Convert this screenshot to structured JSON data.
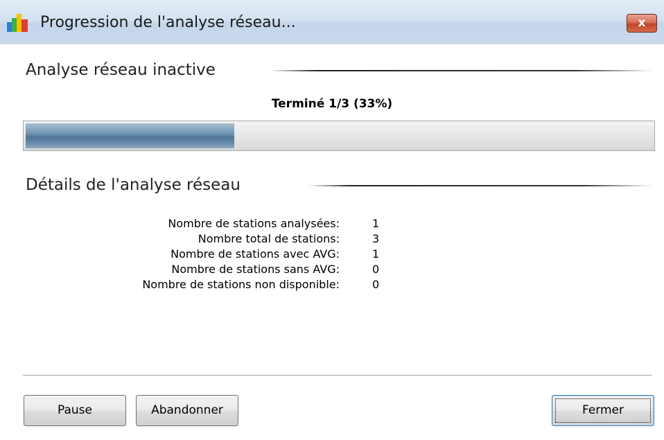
{
  "window": {
    "title": "Progression de l'analyse réseau...",
    "close_glyph": "x"
  },
  "status": {
    "heading": "Analyse réseau inactive",
    "progress_label": "Terminé 1/3 (33%)",
    "progress_fraction": 0.333
  },
  "details": {
    "heading": "Détails de l'analyse réseau",
    "rows": [
      {
        "label": "Nombre de stations analysées:",
        "value": "1"
      },
      {
        "label": "Nombre total de stations:",
        "value": "3"
      },
      {
        "label": "Nombre de stations avec AVG:",
        "value": "1"
      },
      {
        "label": "Nombre de stations sans AVG:",
        "value": "0"
      },
      {
        "label": "Nombre de stations non disponible:",
        "value": "0"
      }
    ]
  },
  "buttons": {
    "pause": "Pause",
    "abandon": "Abandonner",
    "close": "Fermer"
  },
  "colors": {
    "progress_fill": "#4f7797",
    "titlebar": "#d3e1f0",
    "close_button": "#c2452b"
  },
  "icons": {
    "app": "avg-logo-icon",
    "close": "close-icon"
  }
}
